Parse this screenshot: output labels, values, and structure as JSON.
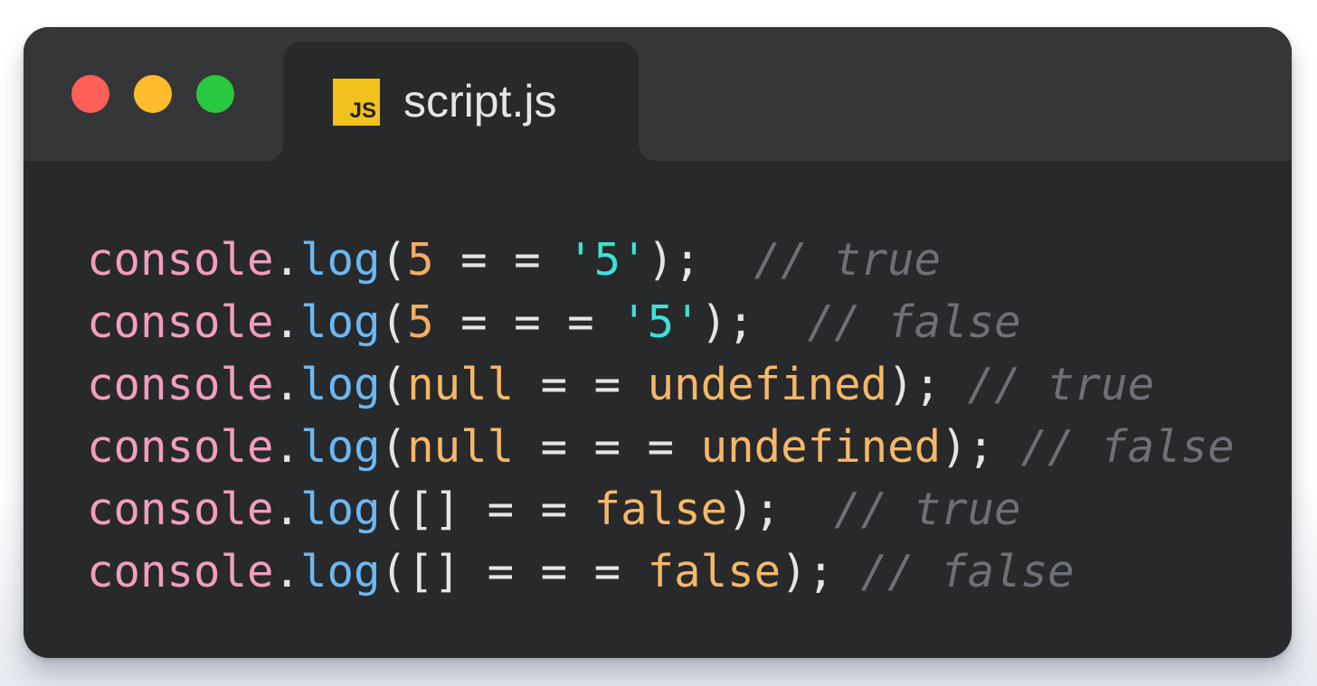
{
  "window": {
    "buttons": [
      {
        "name": "close",
        "color": "#fe5f57"
      },
      {
        "name": "minimize",
        "color": "#febc2e"
      },
      {
        "name": "maximize",
        "color": "#28c840"
      }
    ]
  },
  "tab": {
    "icon": "js-file-icon",
    "icon_text": "JS",
    "title": "script.js"
  },
  "colors": {
    "object": "#f29dbf",
    "method": "#6cb8f2",
    "punct": "#e4e5e6",
    "number": "#f3ad64",
    "string": "#3ee1d6",
    "keyword": "#f5b868",
    "comment": "#6e7078"
  },
  "code": {
    "lines": [
      [
        {
          "t": "console",
          "k": "object"
        },
        {
          "t": ".",
          "k": "punct"
        },
        {
          "t": "log",
          "k": "method"
        },
        {
          "t": "(",
          "k": "punct"
        },
        {
          "t": "5",
          "k": "number"
        },
        {
          "t": " = = ",
          "k": "punct"
        },
        {
          "t": "'5'",
          "k": "string"
        },
        {
          "t": ");  ",
          "k": "punct"
        },
        {
          "t": "// true",
          "k": "comment"
        }
      ],
      [
        {
          "t": "console",
          "k": "object"
        },
        {
          "t": ".",
          "k": "punct"
        },
        {
          "t": "log",
          "k": "method"
        },
        {
          "t": "(",
          "k": "punct"
        },
        {
          "t": "5",
          "k": "number"
        },
        {
          "t": " = = = ",
          "k": "punct"
        },
        {
          "t": "'5'",
          "k": "string"
        },
        {
          "t": ");  ",
          "k": "punct"
        },
        {
          "t": "// false",
          "k": "comment"
        }
      ],
      [
        {
          "t": "console",
          "k": "object"
        },
        {
          "t": ".",
          "k": "punct"
        },
        {
          "t": "log",
          "k": "method"
        },
        {
          "t": "(",
          "k": "punct"
        },
        {
          "t": "null",
          "k": "keyword"
        },
        {
          "t": " = = ",
          "k": "punct"
        },
        {
          "t": "undefined",
          "k": "keyword"
        },
        {
          "t": "); ",
          "k": "punct"
        },
        {
          "t": "// true",
          "k": "comment"
        }
      ],
      [
        {
          "t": "console",
          "k": "object"
        },
        {
          "t": ".",
          "k": "punct"
        },
        {
          "t": "log",
          "k": "method"
        },
        {
          "t": "(",
          "k": "punct"
        },
        {
          "t": "null",
          "k": "keyword"
        },
        {
          "t": " = = = ",
          "k": "punct"
        },
        {
          "t": "undefined",
          "k": "keyword"
        },
        {
          "t": "); ",
          "k": "punct"
        },
        {
          "t": "// false",
          "k": "comment"
        }
      ],
      [
        {
          "t": "console",
          "k": "object"
        },
        {
          "t": ".",
          "k": "punct"
        },
        {
          "t": "log",
          "k": "method"
        },
        {
          "t": "(",
          "k": "punct"
        },
        {
          "t": "[]",
          "k": "punct"
        },
        {
          "t": " = = ",
          "k": "punct"
        },
        {
          "t": "false",
          "k": "keyword"
        },
        {
          "t": ");  ",
          "k": "punct"
        },
        {
          "t": "// true",
          "k": "comment"
        }
      ],
      [
        {
          "t": "console",
          "k": "object"
        },
        {
          "t": ".",
          "k": "punct"
        },
        {
          "t": "log",
          "k": "method"
        },
        {
          "t": "(",
          "k": "punct"
        },
        {
          "t": "[]",
          "k": "punct"
        },
        {
          "t": " = = = ",
          "k": "punct"
        },
        {
          "t": "false",
          "k": "keyword"
        },
        {
          "t": "); ",
          "k": "punct"
        },
        {
          "t": "// false",
          "k": "comment"
        }
      ]
    ]
  }
}
